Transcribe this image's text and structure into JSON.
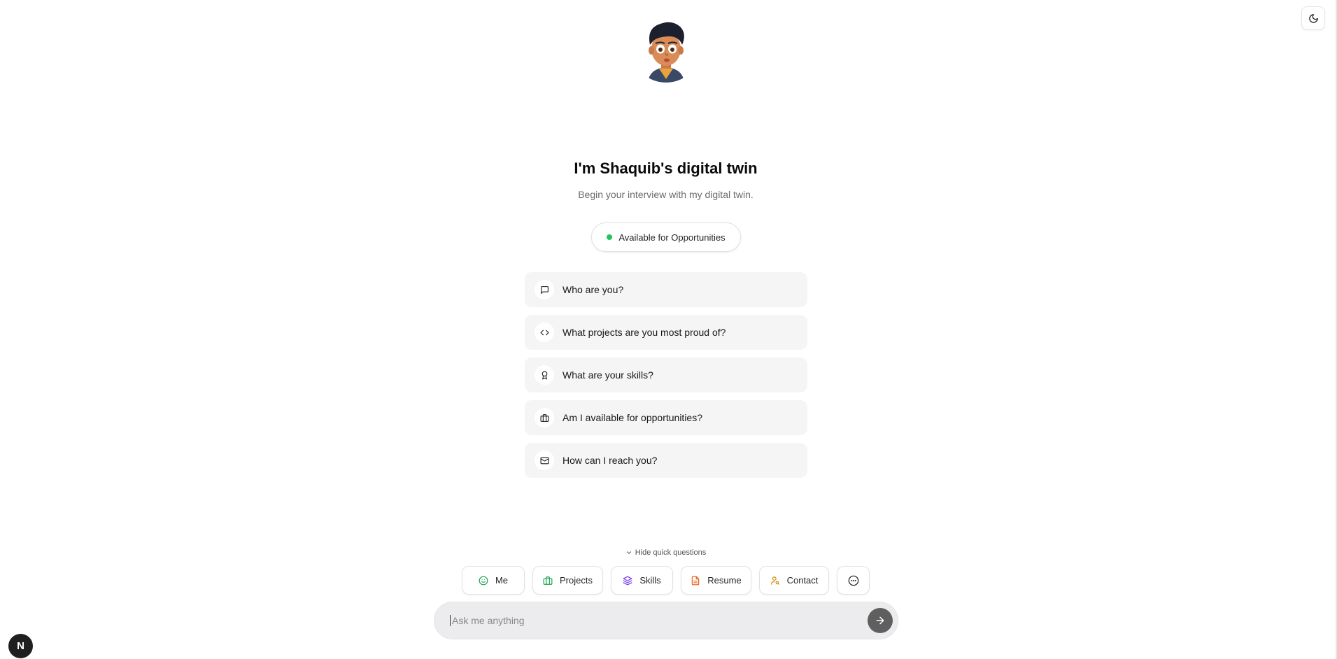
{
  "header": {
    "title": "I'm Shaquib's digital twin",
    "subtitle": "Begin your interview with my digital twin."
  },
  "status": {
    "label": "Available for Opportunities",
    "color": "#22c55e"
  },
  "questions": [
    {
      "label": "Who are you?",
      "icon": "message-square-icon"
    },
    {
      "label": "What projects are you most proud of?",
      "icon": "code-icon"
    },
    {
      "label": "What are your skills?",
      "icon": "award-icon"
    },
    {
      "label": "Am I available for opportunities?",
      "icon": "briefcase-icon"
    },
    {
      "label": "How can I reach you?",
      "icon": "mail-icon"
    }
  ],
  "quick": {
    "toggle_label": "Hide quick questions",
    "chips": [
      {
        "label": "Me",
        "icon": "smile-icon",
        "color": "#16a34a"
      },
      {
        "label": "Projects",
        "icon": "briefcase-icon",
        "color": "#16a34a"
      },
      {
        "label": "Skills",
        "icon": "layers-icon",
        "color": "#7c3aed"
      },
      {
        "label": "Resume",
        "icon": "file-text-icon",
        "color": "#ea580c"
      },
      {
        "label": "Contact",
        "icon": "user-search-icon",
        "color": "#ca8a04"
      }
    ]
  },
  "input": {
    "placeholder": "Ask me anything"
  },
  "badge": {
    "label": "N"
  }
}
